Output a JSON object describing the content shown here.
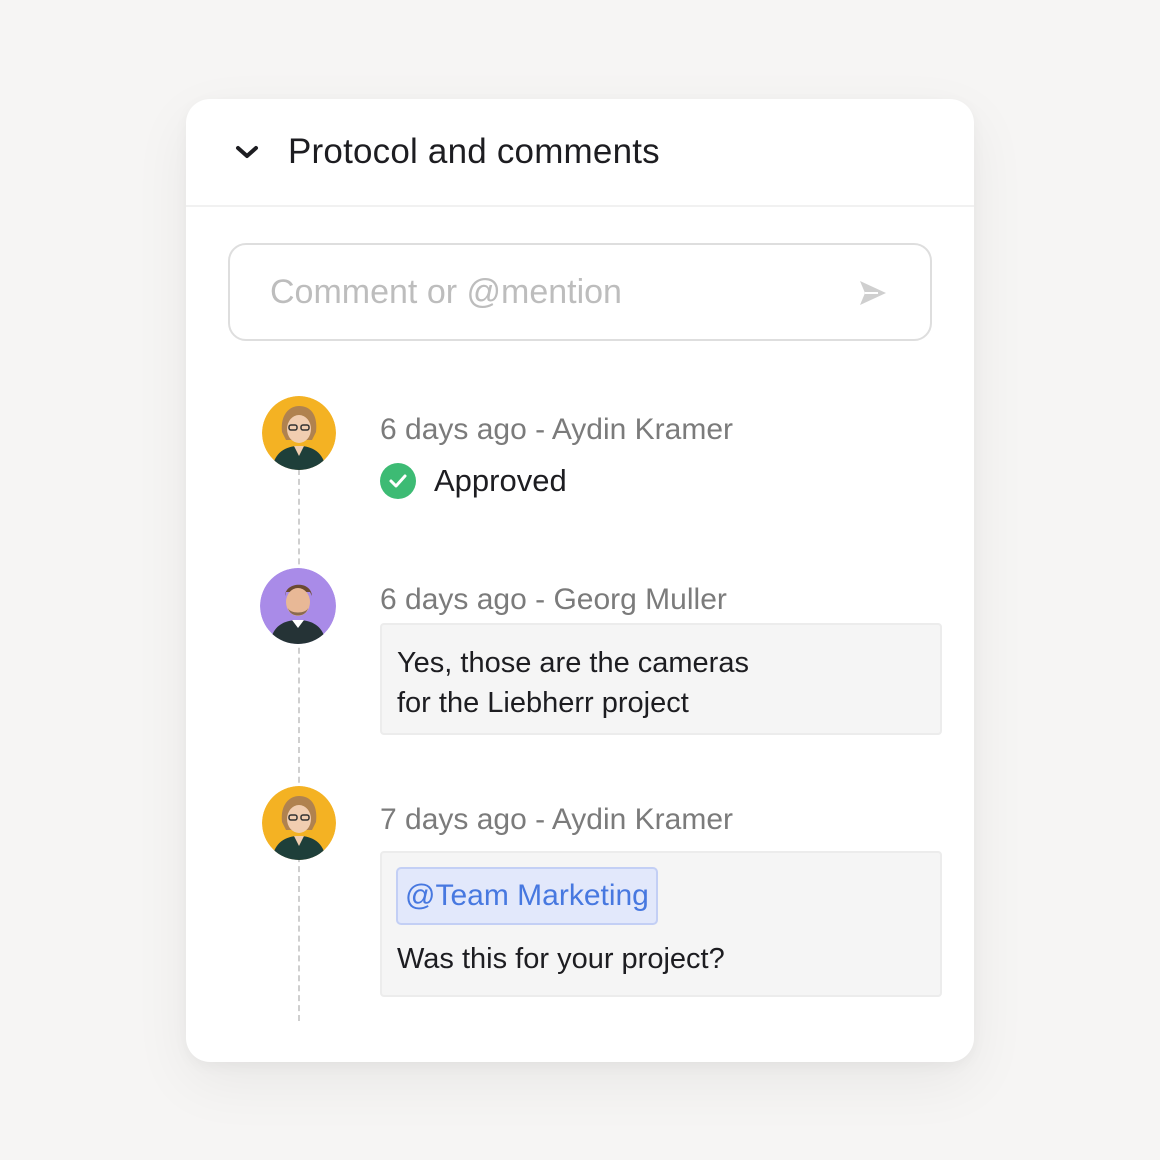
{
  "panel": {
    "title": "Protocol and comments",
    "collapse_icon": "chevron-down-icon"
  },
  "comment_input": {
    "placeholder": "Comment or @mention",
    "send_icon": "send-icon"
  },
  "entries": [
    {
      "time": "6 days ago",
      "separator": "-",
      "author": "Aydin Kramer",
      "avatar_bg": "#f4b223",
      "status": "Approved",
      "status_icon": "check-circle-icon",
      "status_color": "#3dbb74"
    },
    {
      "time": "6 days ago",
      "separator": "-",
      "author": "Georg Muller",
      "avatar_bg": "#a98be8",
      "message_line1": "Yes, those are the cameras",
      "message_line2": "for the Liebherr project"
    },
    {
      "time": "7 days ago",
      "separator": "-",
      "author": "Aydin Kramer",
      "avatar_bg": "#f4b223",
      "mention": "@Team Marketing",
      "message": "Was this for your project?"
    }
  ],
  "colors": {
    "background": "#f6f5f4",
    "card": "#ffffff",
    "mention_text": "#4778e0",
    "mention_bg": "#e2e8fb"
  }
}
